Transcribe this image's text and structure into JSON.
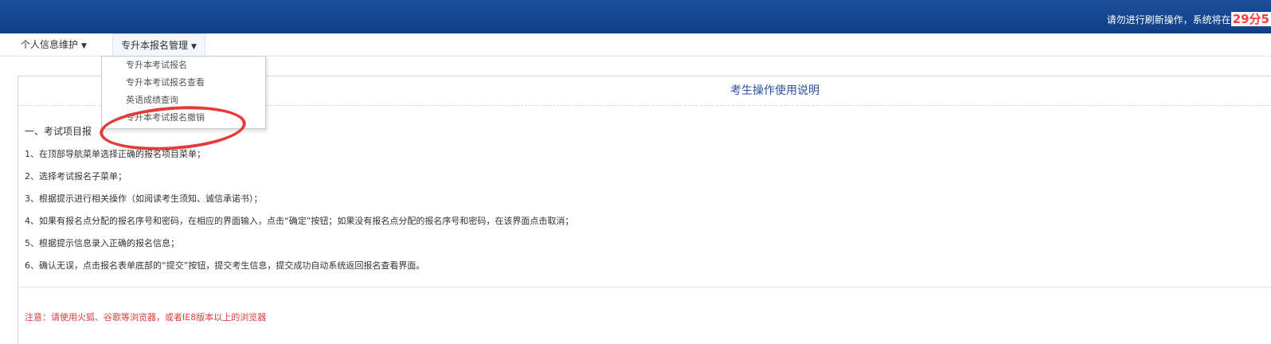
{
  "header": {
    "warning_text": "请勿进行刷新操作，系统将在",
    "timer_text": "29分5"
  },
  "menubar": {
    "personal_info": "个人信息维护",
    "upgrade_registration": "专升本报名管理"
  },
  "dropdown": {
    "items": [
      "专升本考试报名",
      "专升本考试报名查看",
      "英语成绩查询",
      "专升本考试报名撤销"
    ]
  },
  "panel": {
    "title": "考生操作使用说明",
    "section_heading": "一、考试项目报",
    "steps": [
      "1、在顶部导航菜单选择正确的报名项目菜单；",
      "2、选择考试报名子菜单；",
      "3、根据提示进行相关操作（如阅读考生须知、诚信承诺书）；",
      "4、如果有报名点分配的报名序号和密码，在相应的界面输入，点击“确定”按钮；如果没有报名点分配的报名序号和密码，在该界面点击取消；",
      "5、根据提示信息录入正确的报名信息；",
      "6、确认无误，点击报名表单底部的“提交”按钮，提交考生信息，提交成功自动系统返回报名查看界面。"
    ],
    "note": "注意：请使用火狐、谷歌等浏览器，或者IE8版本以上的浏览器"
  },
  "colors": {
    "header_bg": "#14468f",
    "timer": "#ff3b3b",
    "title": "#2d4fa8",
    "note": "#e03a3a",
    "highlight_circle": "#e53a3a"
  }
}
